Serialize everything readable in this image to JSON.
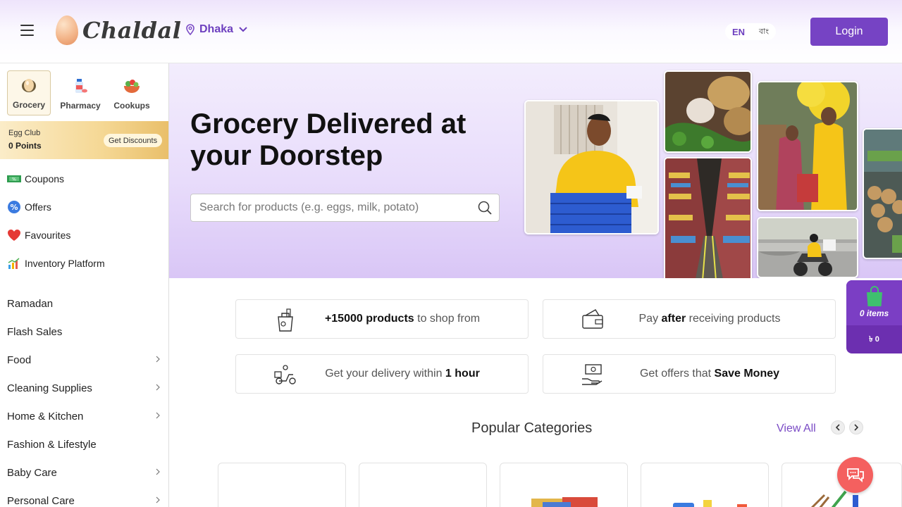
{
  "header": {
    "logo_text": "Chaldal",
    "location": "Dhaka",
    "lang_en": "EN",
    "lang_bn": "বাং",
    "login_label": "Login"
  },
  "sidebar": {
    "tabs": [
      {
        "label": "Grocery",
        "icon": "egg-icon",
        "active": true
      },
      {
        "label": "Pharmacy",
        "icon": "medicine-icon",
        "active": false
      },
      {
        "label": "Cookups",
        "icon": "food-bowl-icon",
        "active": false
      }
    ],
    "egg_club": {
      "title": "Egg Club",
      "points": "0 Points",
      "button": "Get Discounts"
    },
    "links": [
      {
        "label": "Coupons",
        "icon": "coupon-icon"
      },
      {
        "label": "Offers",
        "icon": "offer-badge-icon"
      },
      {
        "label": "Favourites",
        "icon": "heart-icon"
      },
      {
        "label": "Inventory Platform",
        "icon": "bar-chart-icon"
      }
    ],
    "categories": [
      {
        "label": "Ramadan",
        "has_children": false
      },
      {
        "label": "Flash Sales",
        "has_children": false
      },
      {
        "label": "Food",
        "has_children": true
      },
      {
        "label": "Cleaning Supplies",
        "has_children": true
      },
      {
        "label": "Home & Kitchen",
        "has_children": true
      },
      {
        "label": "Fashion & Lifestyle",
        "has_children": false
      },
      {
        "label": "Baby Care",
        "has_children": true
      },
      {
        "label": "Personal Care",
        "has_children": true
      }
    ]
  },
  "hero": {
    "title": "Grocery Delivered at your Doorstep",
    "search_placeholder": "Search for products (e.g. eggs, milk, potato)"
  },
  "features": [
    {
      "bold": "+15000 products",
      "rest": " to shop from",
      "icon": "grocery-bag-icon"
    },
    {
      "pre": "Pay ",
      "bold": "after",
      "rest": " receiving products",
      "icon": "wallet-icon"
    },
    {
      "pre": "Get your delivery within ",
      "bold": "1 hour",
      "icon": "delivery-scooter-icon"
    },
    {
      "pre": "Get offers that ",
      "bold": "Save Money",
      "icon": "money-hand-icon"
    }
  ],
  "popular": {
    "title": "Popular Categories",
    "view_all": "View All"
  },
  "cart": {
    "items": "0 items",
    "amount": "৳ 0"
  },
  "colors": {
    "brand_purple": "#7643c4",
    "hero_lavender": "#e8dcfb",
    "chat_red": "#f4605f"
  }
}
